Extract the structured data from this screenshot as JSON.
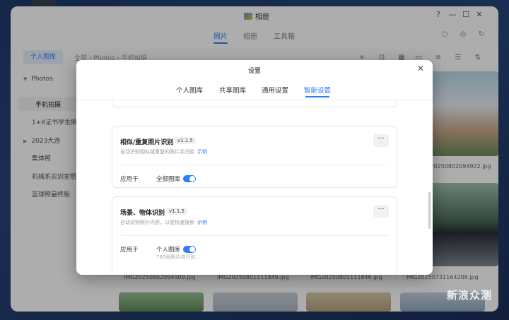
{
  "app": {
    "title": "相册",
    "controls": {
      "help": "?",
      "minimize": "—",
      "maximize": "☐",
      "close": "✕"
    }
  },
  "topnav": {
    "tabs": [
      {
        "label": "照片",
        "active": true
      },
      {
        "label": "相册",
        "active": false
      },
      {
        "label": "工具箱",
        "active": false
      }
    ]
  },
  "sidebar": {
    "button": "个人图库",
    "items": [
      {
        "label": "Photos",
        "caret": "▼"
      },
      {
        "label": "手机拍摄"
      },
      {
        "label": "1+X证书学生照片"
      },
      {
        "label": "2023大连",
        "caret": "▶"
      },
      {
        "label": "集体照"
      },
      {
        "label": "机械系实训室照片"
      },
      {
        "label": "篮球照最终版"
      }
    ]
  },
  "breadcrumb": "全部 › Photos › 手机拍摄",
  "photos": {
    "names": [
      "IMG20250802094922.jpg",
      "IMG20250802094909.jpg",
      "IMG20250801111849.jpg",
      "IMG20250801111846.jpg",
      "IMG20250731164208.jpg"
    ]
  },
  "dialog": {
    "title": "设置",
    "close": "✕",
    "tabs": [
      {
        "label": "个人图库",
        "active": false
      },
      {
        "label": "共享图库",
        "active": false
      },
      {
        "label": "通用设置",
        "active": false
      },
      {
        "label": "智能设置",
        "active": true
      }
    ],
    "cards": [
      {
        "title": "相似/重复照片识别",
        "version": "v1.1.5",
        "desc": "自动识别相似或重复的照片并归类",
        "link": "示例",
        "more": "···",
        "apply_label": "应用于",
        "apply_value": "全部图库",
        "enabled": true
      },
      {
        "title": "场景、物体识别",
        "version": "v1.1.5",
        "desc": "自动识别照片内容，以便快速搜索",
        "link": "示例",
        "more": "···",
        "apply_label": "应用于",
        "apply_value": "个人图库",
        "note": "765张照片待识别...",
        "enabled": true
      }
    ]
  },
  "watermark": "新浪众测",
  "colors": {
    "accent": "#2f7df6",
    "toggle_on": "#2f7df6"
  }
}
